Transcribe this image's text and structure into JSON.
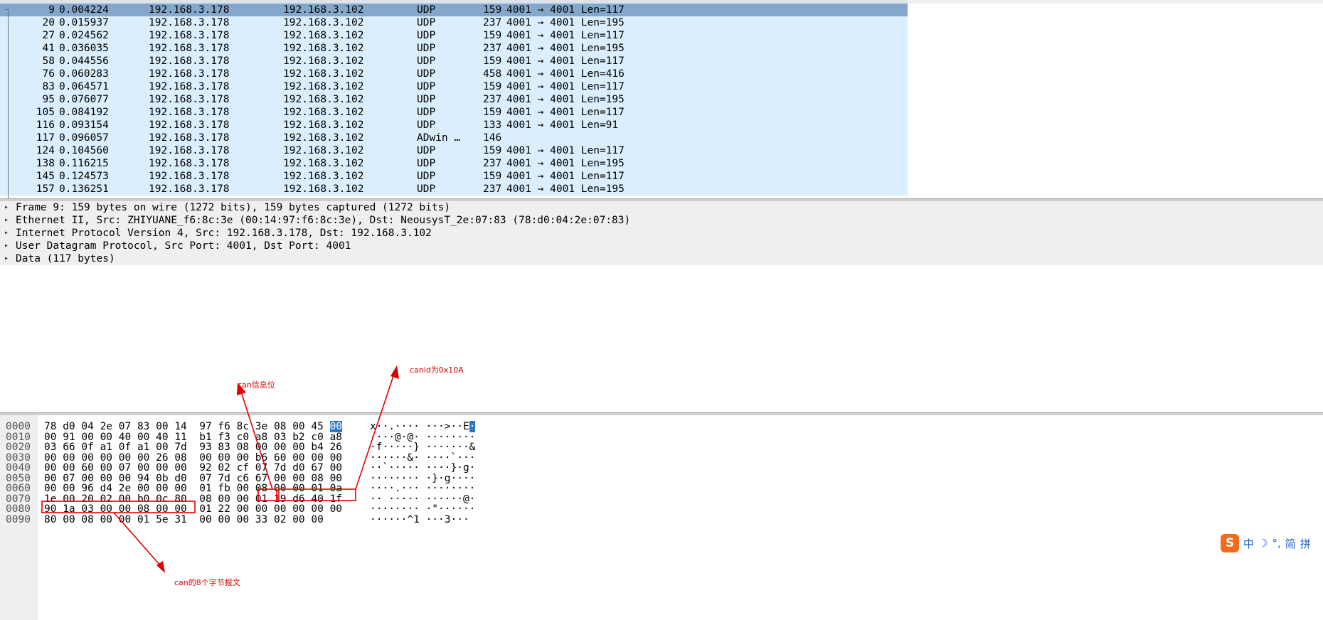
{
  "packet_list": {
    "rows": [
      {
        "no": "9",
        "time": "0.004224",
        "src": "192.168.3.178",
        "dst": "192.168.3.102",
        "proto": "UDP",
        "len": "159",
        "info": "4001 → 4001 Len=117",
        "selected": true
      },
      {
        "no": "20",
        "time": "0.015937",
        "src": "192.168.3.178",
        "dst": "192.168.3.102",
        "proto": "UDP",
        "len": "237",
        "info": "4001 → 4001 Len=195"
      },
      {
        "no": "27",
        "time": "0.024562",
        "src": "192.168.3.178",
        "dst": "192.168.3.102",
        "proto": "UDP",
        "len": "159",
        "info": "4001 → 4001 Len=117"
      },
      {
        "no": "41",
        "time": "0.036035",
        "src": "192.168.3.178",
        "dst": "192.168.3.102",
        "proto": "UDP",
        "len": "237",
        "info": "4001 → 4001 Len=195"
      },
      {
        "no": "58",
        "time": "0.044556",
        "src": "192.168.3.178",
        "dst": "192.168.3.102",
        "proto": "UDP",
        "len": "159",
        "info": "4001 → 4001 Len=117"
      },
      {
        "no": "76",
        "time": "0.060283",
        "src": "192.168.3.178",
        "dst": "192.168.3.102",
        "proto": "UDP",
        "len": "458",
        "info": "4001 → 4001 Len=416"
      },
      {
        "no": "83",
        "time": "0.064571",
        "src": "192.168.3.178",
        "dst": "192.168.3.102",
        "proto": "UDP",
        "len": "159",
        "info": "4001 → 4001 Len=117"
      },
      {
        "no": "95",
        "time": "0.076077",
        "src": "192.168.3.178",
        "dst": "192.168.3.102",
        "proto": "UDP",
        "len": "237",
        "info": "4001 → 4001 Len=195"
      },
      {
        "no": "105",
        "time": "0.084192",
        "src": "192.168.3.178",
        "dst": "192.168.3.102",
        "proto": "UDP",
        "len": "159",
        "info": "4001 → 4001 Len=117"
      },
      {
        "no": "116",
        "time": "0.093154",
        "src": "192.168.3.178",
        "dst": "192.168.3.102",
        "proto": "UDP",
        "len": "133",
        "info": "4001 → 4001 Len=91"
      },
      {
        "no": "117",
        "time": "0.096057",
        "src": "192.168.3.178",
        "dst": "192.168.3.102",
        "proto": "ADwin …",
        "len": "146",
        "info": ""
      },
      {
        "no": "124",
        "time": "0.104560",
        "src": "192.168.3.178",
        "dst": "192.168.3.102",
        "proto": "UDP",
        "len": "159",
        "info": "4001 → 4001 Len=117"
      },
      {
        "no": "138",
        "time": "0.116215",
        "src": "192.168.3.178",
        "dst": "192.168.3.102",
        "proto": "UDP",
        "len": "237",
        "info": "4001 → 4001 Len=195"
      },
      {
        "no": "145",
        "time": "0.124573",
        "src": "192.168.3.178",
        "dst": "192.168.3.102",
        "proto": "UDP",
        "len": "159",
        "info": "4001 → 4001 Len=117"
      },
      {
        "no": "157",
        "time": "0.136251",
        "src": "192.168.3.178",
        "dst": "192.168.3.102",
        "proto": "UDP",
        "len": "237",
        "info": "4001 → 4001 Len=195"
      }
    ]
  },
  "details": {
    "lines": [
      "Frame 9: 159 bytes on wire (1272 bits), 159 bytes captured (1272 bits)",
      "Ethernet II, Src: ZHIYUANE_f6:8c:3e (00:14:97:f6:8c:3e), Dst: NeousysT_2e:07:83 (78:d0:04:2e:07:83)",
      "Internet Protocol Version 4, Src: 192.168.3.178, Dst: 192.168.3.102",
      "User Datagram Protocol, Src Port: 4001, Dst Port: 4001",
      "Data (117 bytes)"
    ]
  },
  "bytes": {
    "rows": [
      {
        "off": "0000",
        "hex_a": "78 d0 04 2e 07 83 00 14  97 f6 8c 3e 08 00 45 ",
        "hex_sel": "00",
        "asc_a": "x··.···· ···>··E",
        "asc_sel": "·"
      },
      {
        "off": "0010",
        "hex_a": "00 91 00 00 40 00 40 11  b1 f3 c0 a8 03 b2 c0 a8",
        "hex_sel": "",
        "asc_a": "····@·@· ········",
        "asc_sel": ""
      },
      {
        "off": "0020",
        "hex_a": "03 66 0f a1 0f a1 00 7d  93 83 08 00 00 00 b4 26",
        "hex_sel": "",
        "asc_a": "·f·····} ·······&",
        "asc_sel": ""
      },
      {
        "off": "0030",
        "hex_a": "00 00 00 00 00 00 26 08  00 00 00 b6 60 00 00 00",
        "hex_sel": "",
        "asc_a": "······&· ····`···",
        "asc_sel": ""
      },
      {
        "off": "0040",
        "hex_a": "00 00 60 00 07 00 00 00  92 02 cf 07 7d d0 67 00",
        "hex_sel": "",
        "asc_a": "··`····· ····}·g·",
        "asc_sel": ""
      },
      {
        "off": "0050",
        "hex_a": "00 07 00 00 00 94 0b d0  07 7d c6 67 00 00 08 00",
        "hex_sel": "",
        "asc_a": "········ ·}·g····",
        "asc_sel": ""
      },
      {
        "off": "0060",
        "hex_a": "00 00 96 d4 2e 00 00 00  01 fb 00 08 00 00 01 0a",
        "hex_sel": "",
        "asc_a": "····.··· ········",
        "asc_sel": ""
      },
      {
        "off": "0070",
        "hex_a": "1e 00 20 02 00 b0 0c 80  08 00 00 01 19 d6 40 1f",
        "hex_sel": "",
        "asc_a": "·· ····· ······@·",
        "asc_sel": ""
      },
      {
        "off": "0080",
        "hex_a": "90 1a 03 00 00 08 00 00  01 22 00 00 00 00 00 00",
        "hex_sel": "",
        "asc_a": "········ ·\"······",
        "asc_sel": ""
      },
      {
        "off": "0090",
        "hex_a": "80 00 08 00 00 01 5e 31  00 00 00 33 02 00 00",
        "hex_sel": "",
        "asc_a": "······^1 ···3···",
        "asc_sel": ""
      }
    ]
  },
  "annotations": {
    "can_info": "can信息位",
    "can_id": "canid为0x10A",
    "can_bytes": "can的8个字节报文",
    "color": "#e00000"
  },
  "ime": {
    "logo": "S",
    "items": [
      "中",
      "☽",
      "°,",
      "简",
      "拼"
    ]
  },
  "colors": {
    "row_bg": "#daeefe",
    "row_selected": "#84a8cb",
    "byte_highlight": "#2a79c2"
  }
}
